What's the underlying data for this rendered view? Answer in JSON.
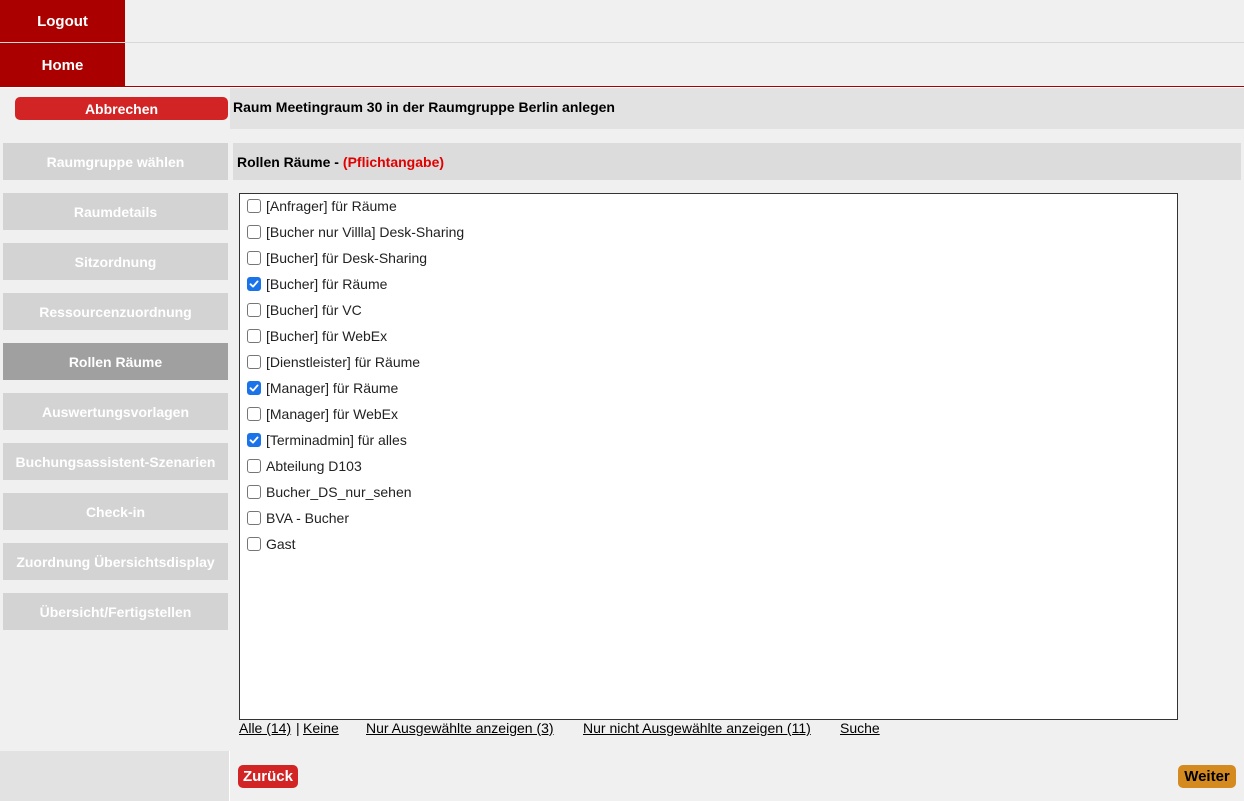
{
  "nav": {
    "logout_label": "Logout",
    "home_label": "Home"
  },
  "header": {
    "cancel_label": "Abbrechen",
    "title": "Raum Meetingraum 30 in der Raumgruppe Berlin anlegen"
  },
  "sidebar": {
    "items": [
      {
        "label": "Raumgruppe wählen"
      },
      {
        "label": "Raumdetails"
      },
      {
        "label": "Sitzordnung"
      },
      {
        "label": "Ressourcenzuordnung"
      },
      {
        "label": "Rollen Räume",
        "active": true
      },
      {
        "label": "Auswertungsvorlagen"
      },
      {
        "label": "Buchungsassistent-Szenarien"
      },
      {
        "label": "Check-in"
      },
      {
        "label": "Zuordnung Übersichtsdisplay"
      },
      {
        "label": "Übersicht/Fertigstellen"
      }
    ]
  },
  "section": {
    "title": "Rollen Räume -",
    "required_label": "(Pflichtangabe)"
  },
  "roles": [
    {
      "label": "[Anfrager] für Räume",
      "checked": false
    },
    {
      "label": "[Bucher nur Villla] Desk-Sharing",
      "checked": false
    },
    {
      "label": "[Bucher] für Desk-Sharing",
      "checked": false
    },
    {
      "label": "[Bucher] für Räume",
      "checked": true
    },
    {
      "label": "[Bucher] für VC",
      "checked": false
    },
    {
      "label": "[Bucher] für WebEx",
      "checked": false
    },
    {
      "label": "[Dienstleister] für Räume",
      "checked": false
    },
    {
      "label": "[Manager] für Räume",
      "checked": true
    },
    {
      "label": "[Manager] für WebEx",
      "checked": false
    },
    {
      "label": "[Terminadmin] für alles",
      "checked": true
    },
    {
      "label": "Abteilung D103",
      "checked": false
    },
    {
      "label": "Bucher_DS_nur_sehen",
      "checked": false
    },
    {
      "label": "BVA - Bucher",
      "checked": false
    },
    {
      "label": "Gast",
      "checked": false
    }
  ],
  "links": {
    "all": "Alle (14)",
    "separator": "|",
    "none": "Keine",
    "only_selected": "Nur Ausgewählte anzeigen (3)",
    "only_unselected": "Nur nicht Ausgewählte anzeigen (11)",
    "search": "Suche"
  },
  "footer": {
    "back_label": "Zurück",
    "next_label": "Weiter"
  },
  "colors": {
    "brand_red": "#aa0000",
    "button_red": "#d22424",
    "next_orange": "#d58a1f",
    "checkbox_blue": "#1a73e8"
  }
}
